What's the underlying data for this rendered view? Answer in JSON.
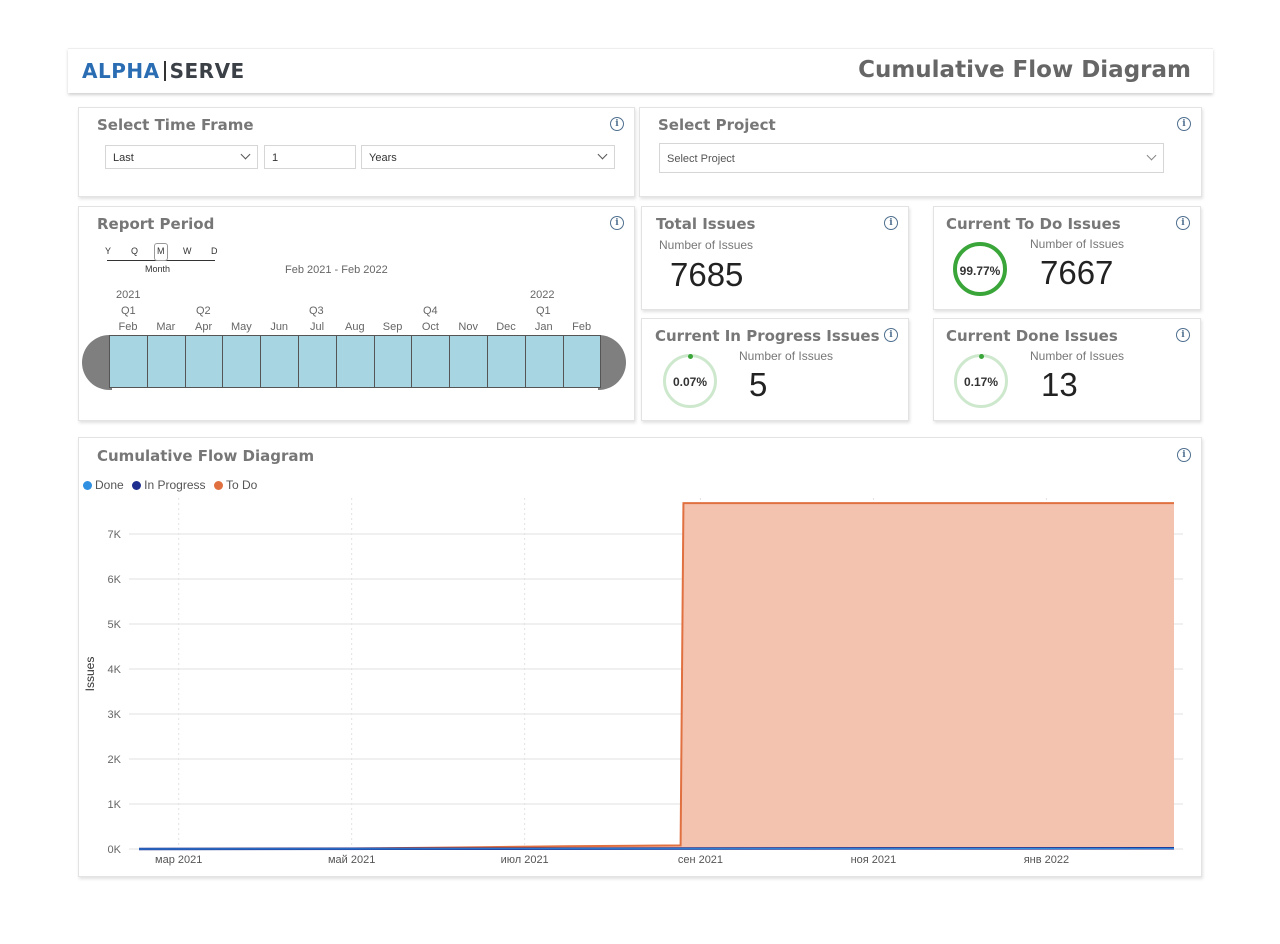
{
  "header": {
    "logo_left": "ALPHA",
    "logo_right": "SERVE",
    "title": "Cumulative Flow Diagram"
  },
  "time_frame": {
    "title": "Select Time Frame",
    "mode": "Last",
    "count": "1",
    "unit": "Years"
  },
  "project": {
    "title": "Select Project",
    "placeholder": "Select Project"
  },
  "report_period": {
    "title": "Report Period",
    "granularity_options": [
      "Y",
      "Q",
      "M",
      "W",
      "D"
    ],
    "granularity_selected": "M",
    "granularity_label": "Month",
    "range_label": "Feb 2021 - Feb 2022",
    "year_labels": [
      "2021",
      "2022"
    ],
    "quarter_labels": [
      "Q1",
      "Q2",
      "Q3",
      "Q4",
      "Q1"
    ],
    "months": [
      "Feb",
      "Mar",
      "Apr",
      "May",
      "Jun",
      "Jul",
      "Aug",
      "Sep",
      "Oct",
      "Nov",
      "Dec",
      "Jan",
      "Feb"
    ]
  },
  "kpis": {
    "total": {
      "title": "Total Issues",
      "subtitle": "Number of Issues",
      "value": "7685"
    },
    "todo": {
      "title": "Current To Do Issues",
      "subtitle": "Number of Issues",
      "value": "7667",
      "percent": "99.77%",
      "percent_value": 99.77
    },
    "in_progress": {
      "title": "Current In Progress Issues",
      "subtitle": "Number of Issues",
      "value": "5",
      "percent": "0.07%",
      "percent_value": 0.07
    },
    "done": {
      "title": "Current Done Issues",
      "subtitle": "Number of Issues",
      "value": "13",
      "percent": "0.17%",
      "percent_value": 0.17
    }
  },
  "colors": {
    "done": "#2f8fe0",
    "in_progress": "#1f2f8f",
    "todo": "#e07040",
    "todo_fill": "#f4c3af",
    "ring_green": "#3aa63a",
    "ring_light": "#cde8cd",
    "timeline_cell": "#a8d5e2"
  },
  "chart": {
    "title": "Cumulative Flow Diagram",
    "legend": [
      "Done",
      "In Progress",
      "To Do"
    ],
    "ylabel": "Issues",
    "y_ticks": [
      "0K",
      "1K",
      "2K",
      "3K",
      "4K",
      "5K",
      "6K",
      "7K"
    ],
    "x_ticks": [
      "мар 2021",
      "май 2021",
      "июл 2021",
      "сен 2021",
      "ноя 2021",
      "янв 2022"
    ]
  },
  "chart_data": {
    "type": "area",
    "title": "Cumulative Flow Diagram",
    "xlabel": "",
    "ylabel": "Issues",
    "ylim": [
      0,
      7700
    ],
    "xlim": [
      "2021-02-15",
      "2022-02-15"
    ],
    "x_ticks": [
      "2021-03-01",
      "2021-05-01",
      "2021-07-01",
      "2021-09-01",
      "2021-11-01",
      "2022-01-01"
    ],
    "grid": true,
    "legend_position": "top-left",
    "series": [
      {
        "name": "Done",
        "points": [
          [
            "2021-02-15",
            0
          ],
          [
            "2022-02-15",
            13
          ]
        ]
      },
      {
        "name": "In Progress",
        "points": [
          [
            "2021-02-15",
            0
          ],
          [
            "2022-02-15",
            18
          ]
        ]
      },
      {
        "name": "To Do",
        "points": [
          [
            "2021-02-15",
            0
          ],
          [
            "2021-05-01",
            10
          ],
          [
            "2021-06-15",
            40
          ],
          [
            "2021-07-15",
            60
          ],
          [
            "2021-08-25",
            80
          ],
          [
            "2021-08-26",
            7685
          ],
          [
            "2022-02-15",
            7685
          ]
        ]
      }
    ]
  }
}
